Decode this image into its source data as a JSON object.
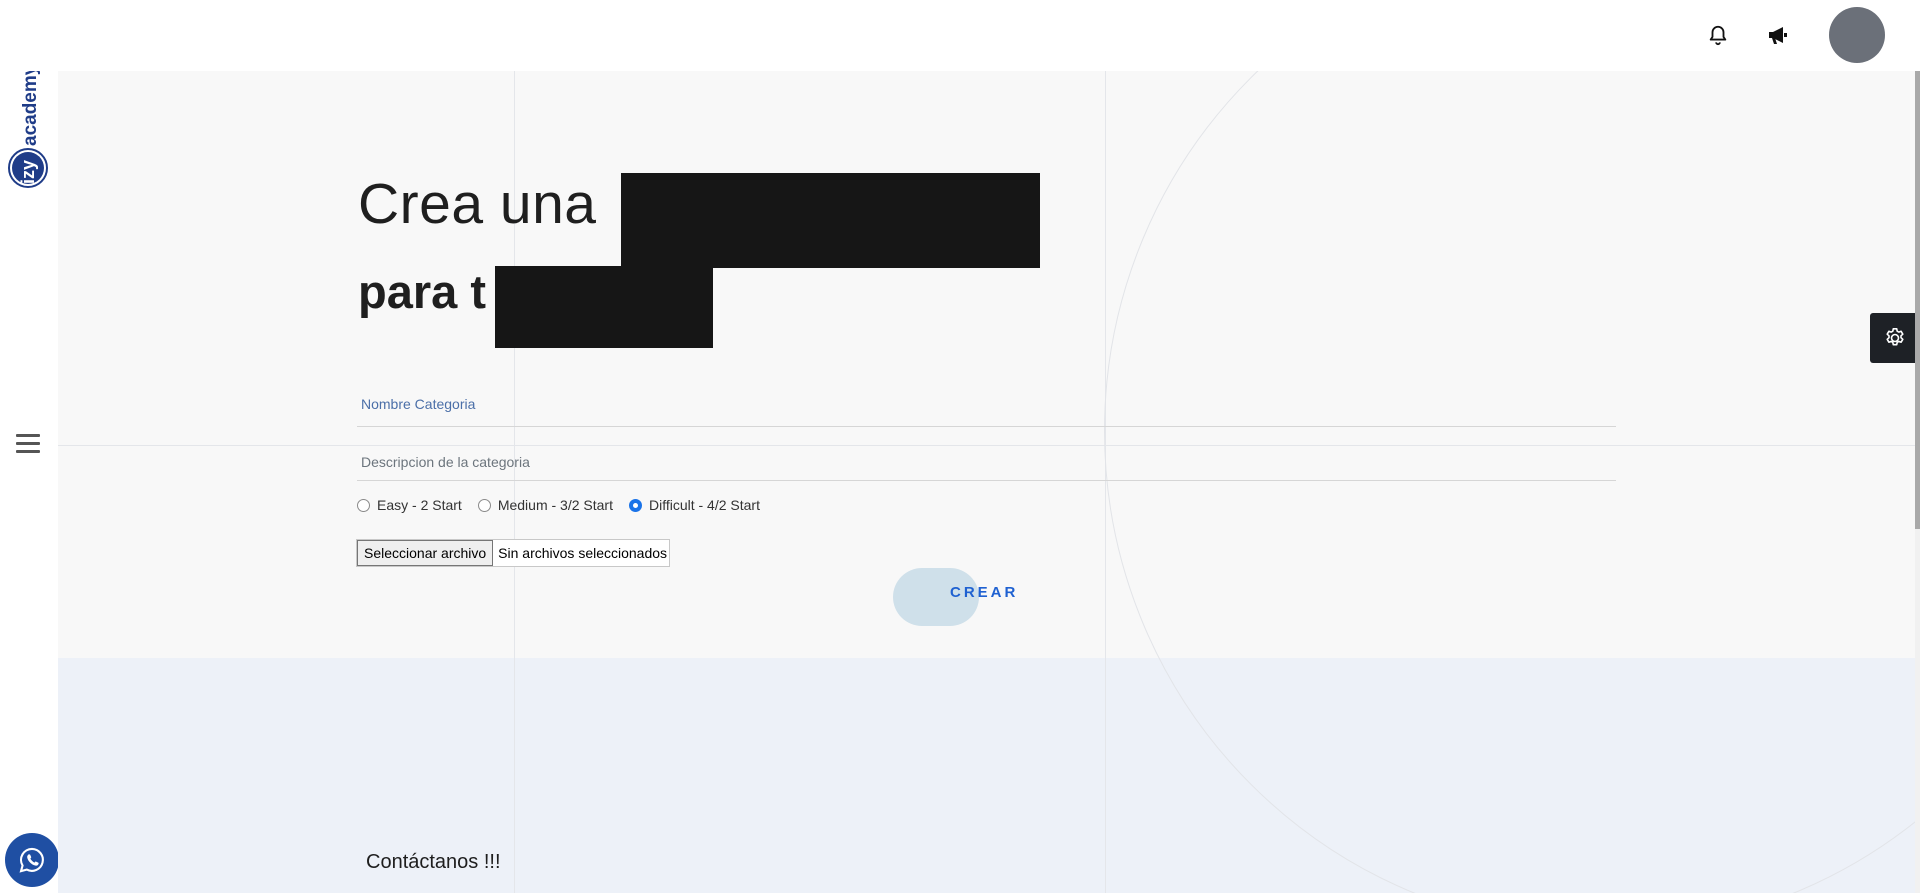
{
  "brand": {
    "logo_text": "izyacademy"
  },
  "header": {
    "icons": [
      "bell-icon",
      "megaphone-icon",
      "avatar"
    ]
  },
  "hero": {
    "title_line1": "Crea una",
    "title_line2": "para t"
  },
  "form": {
    "name_placeholder": "Nombre Categoria",
    "description_placeholder": "Descripcion de la categoria",
    "difficulty_options": [
      {
        "label": "Easy - 2 Start",
        "checked": false
      },
      {
        "label": "Medium - 3/2 Start",
        "checked": false
      },
      {
        "label": "Difficult - 4/2 Start",
        "checked": true
      }
    ],
    "file_button_label": "Seleccionar archivo",
    "file_status": "Sin archivos seleccionados",
    "submit_label": "CREAR"
  },
  "footer": {
    "contact_label": "Contáctanos !!!"
  },
  "colors": {
    "accent": "#1f61d1",
    "whatsapp": "#1f4fa3",
    "lower_band": "#edf1f8",
    "settings_tab": "#1e2126"
  }
}
